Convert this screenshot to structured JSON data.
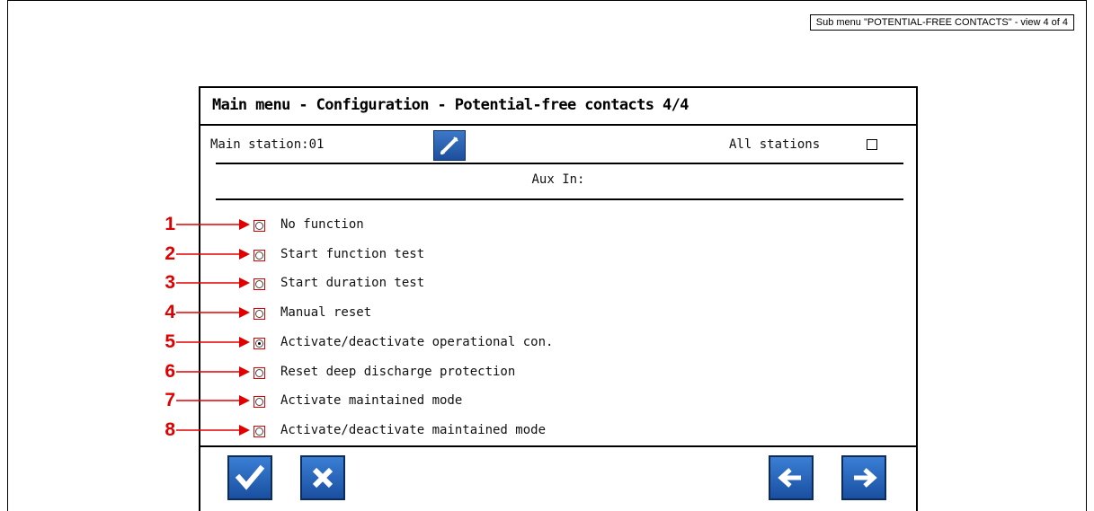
{
  "caption": "Sub menu \"POTENTIAL-FREE CONTACTS\" - view 4 of 4",
  "screen": {
    "title": "Main menu - Configuration - Potential-free contacts 4/4",
    "main_station_label": "Main station:",
    "main_station_value": "01",
    "all_stations_label": "All stations",
    "all_stations_checked": false,
    "section_label": "Aux In:",
    "options": [
      {
        "callout": "1",
        "label": "No function",
        "selected": false
      },
      {
        "callout": "2",
        "label": "Start function test",
        "selected": false
      },
      {
        "callout": "3",
        "label": "Start duration test",
        "selected": false
      },
      {
        "callout": "4",
        "label": "Manual reset",
        "selected": false
      },
      {
        "callout": "5",
        "label": "Activate/deactivate operational con.",
        "selected": true
      },
      {
        "callout": "6",
        "label": "Reset deep discharge protection",
        "selected": false
      },
      {
        "callout": "7",
        "label": "Activate maintained mode",
        "selected": false
      },
      {
        "callout": "8",
        "label": "Activate/deactivate maintained mode",
        "selected": false
      }
    ],
    "buttons": {
      "confirm_icon": "checkmark-icon",
      "cancel_icon": "x-icon",
      "prev_icon": "arrow-left-icon",
      "next_icon": "arrow-right-icon",
      "edit_icon": "pencil-icon"
    }
  },
  "colors": {
    "callout_red": "#e00000",
    "button_blue": "#1a4fa0"
  }
}
